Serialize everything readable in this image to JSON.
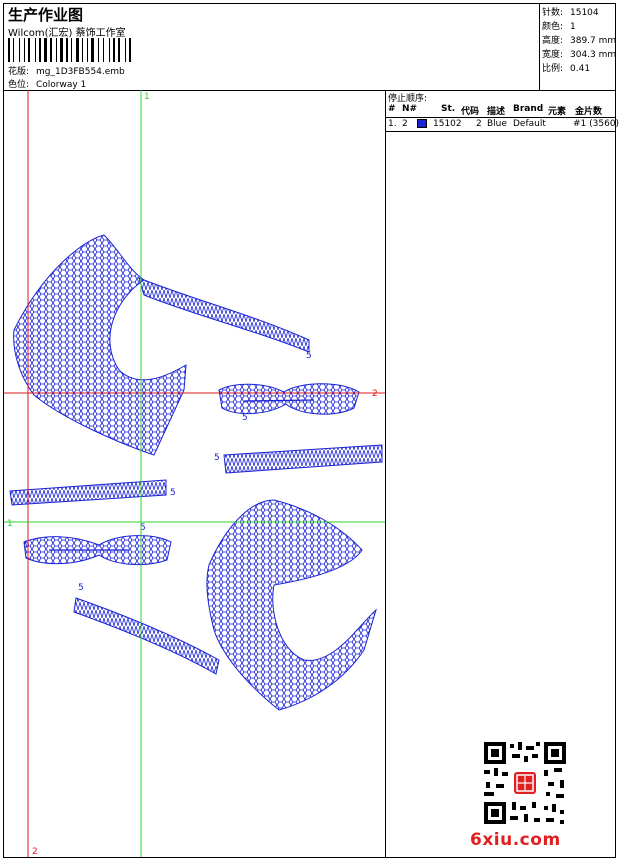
{
  "header": {
    "title": "生产作业图",
    "company": "Wilcom(汇宏) 蔡饰工作室",
    "file_label": "花版:",
    "file_name": "mg_1D3FB554.emb",
    "colorway_label": "色位:",
    "colorway_name": "Colorway 1"
  },
  "stats": [
    {
      "label": "针数:",
      "value": "15104"
    },
    {
      "label": "颜色:",
      "value": "1"
    },
    {
      "label": "高度:",
      "value": "389.7 mm"
    },
    {
      "label": "宽度:",
      "value": "304.3 mm"
    },
    {
      "label": "比例:",
      "value": "0.41"
    }
  ],
  "guides": {
    "vertical_1_label": "1",
    "vertical_2_label": "2",
    "horizontal_1_label": "1",
    "horizontal_2_label": "2",
    "stitch_markers": [
      "5",
      "5",
      "5",
      "5",
      "5",
      "5",
      "5"
    ]
  },
  "stop_sequence": {
    "title": "停止顺序:",
    "columns": [
      "#",
      "N#",
      "St.",
      "代码",
      "描述",
      "Brand",
      "元素",
      "金片数"
    ],
    "rows": [
      {
        "index": "1.",
        "needle": "2",
        "color": "#1a23d6",
        "stitches": "15102",
        "code": "2",
        "description": "Blue",
        "brand": "Default",
        "element": "#1 (3560)"
      }
    ]
  },
  "watermark": "6xiu.com",
  "colors": {
    "thread": "#1a23d6",
    "guide_red": "#d81818",
    "guide_green": "#2fd02f",
    "watermark": "#e02020"
  }
}
